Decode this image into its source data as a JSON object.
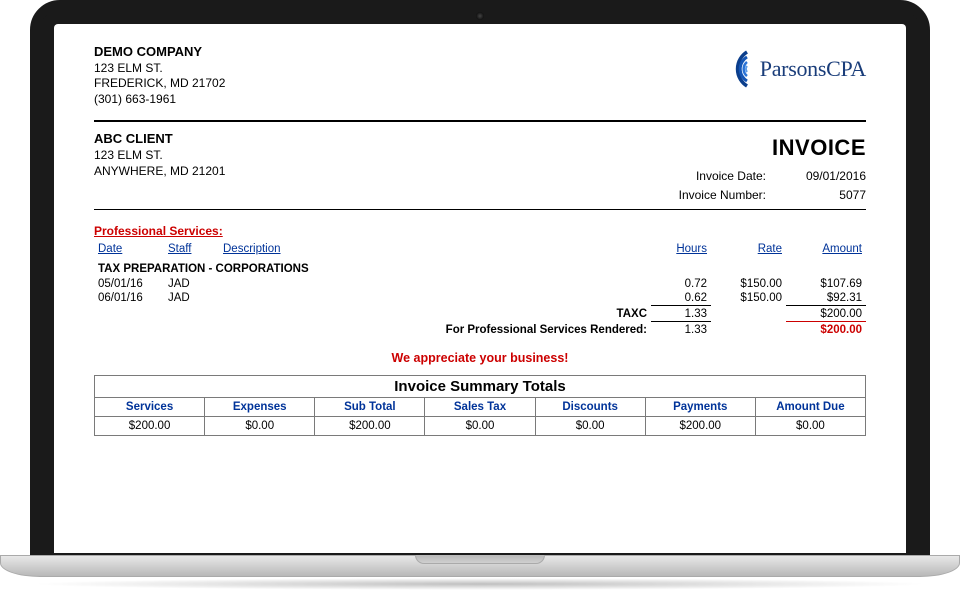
{
  "company": {
    "name": "DEMO COMPANY",
    "street": "123 ELM ST.",
    "city_state_zip": "FREDERICK, MD  21702",
    "phone": "(301) 663-1961"
  },
  "logo_text": "ParsonsCPA",
  "client": {
    "name": "ABC CLIENT",
    "street": "123 ELM ST.",
    "city_state_zip": "ANYWHERE, MD  21201"
  },
  "invoice": {
    "title": "INVOICE",
    "date_label": "Invoice Date:",
    "date": "09/01/2016",
    "number_label": "Invoice Number:",
    "number": "5077"
  },
  "services": {
    "section_title": "Professional Services:",
    "headers": {
      "date": "Date",
      "staff": "Staff",
      "description": "Description",
      "hours": "Hours",
      "rate": "Rate",
      "amount": "Amount"
    },
    "group_heading": "TAX PREPARATION - CORPORATIONS",
    "lines": [
      {
        "date": "05/01/16",
        "staff": "JAD",
        "description": "",
        "hours": "0.72",
        "rate": "$150.00",
        "amount": "$107.69"
      },
      {
        "date": "06/01/16",
        "staff": "JAD",
        "description": "",
        "hours": "0.62",
        "rate": "$150.00",
        "amount": "$92.31"
      }
    ],
    "subtotal_label": "TAXC",
    "subtotal_hours": "1.33",
    "subtotal_amount": "$200.00",
    "rendered_label": "For Professional Services Rendered:",
    "rendered_hours": "1.33",
    "rendered_amount": "$200.00"
  },
  "appreciate": "We appreciate your business!",
  "summary": {
    "title": "Invoice Summary Totals",
    "headers": {
      "services": "Services",
      "expenses": "Expenses",
      "subtotal": "Sub Total",
      "sales_tax": "Sales Tax",
      "discounts": "Discounts",
      "payments": "Payments",
      "amount_due": "Amount Due"
    },
    "values": {
      "services": "$200.00",
      "expenses": "$0.00",
      "subtotal": "$200.00",
      "sales_tax": "$0.00",
      "discounts": "$0.00",
      "payments": "$200.00",
      "amount_due": "$0.00"
    }
  }
}
